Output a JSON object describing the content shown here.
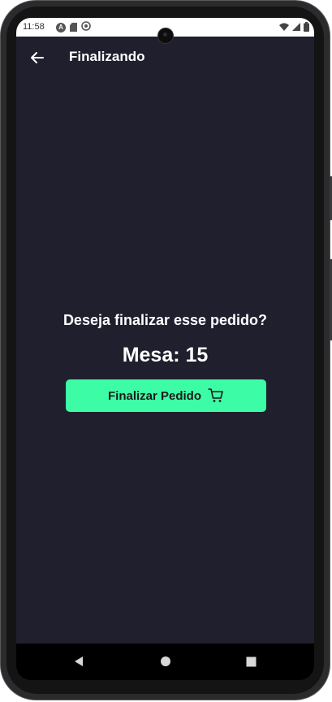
{
  "status_bar": {
    "time": "11:58",
    "left_icons": [
      "a-icon",
      "sd-card-icon",
      "sync-icon"
    ],
    "right_icons": [
      "wifi-icon",
      "signal-icon",
      "battery-icon"
    ]
  },
  "app_bar": {
    "title": "Finalizando",
    "back_icon": "arrow-left-icon"
  },
  "content": {
    "question": "Deseja finalizar esse pedido?",
    "table_label": "Mesa: 15"
  },
  "finish_button": {
    "label": "Finalizar Pedido",
    "icon": "shopping-cart-icon"
  },
  "colors": {
    "background": "#1f1f2e",
    "accent": "#3dfca6",
    "text": "#ffffff"
  },
  "nav_bar": {
    "buttons": [
      "back",
      "home",
      "recents"
    ]
  }
}
